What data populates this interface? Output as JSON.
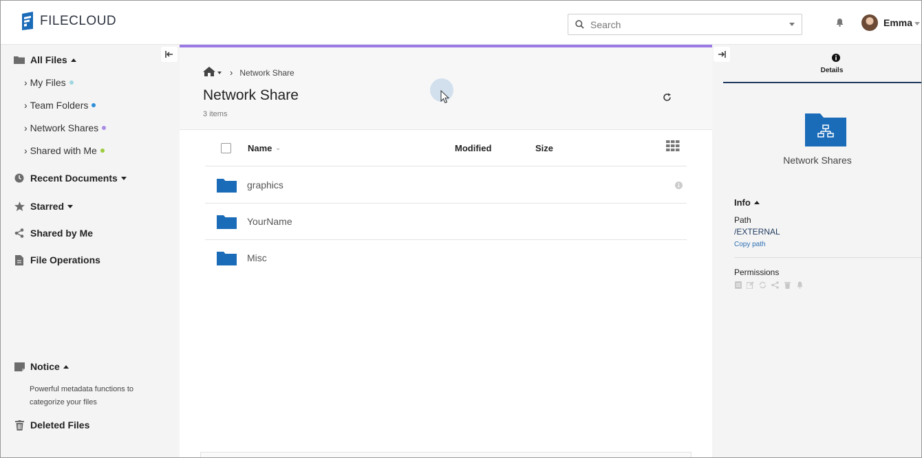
{
  "app": {
    "logo_text": "FILECLOUD",
    "brand_color": "#1a6bb8",
    "accent_color": "#9b7ae6"
  },
  "header": {
    "search_placeholder": "Search",
    "user_name": "Emma"
  },
  "sidebar": {
    "all_files": "All Files",
    "sub_items": [
      {
        "label": "My Files",
        "dot_color": "#9fd7e0"
      },
      {
        "label": "Team Folders",
        "dot_color": "#2e8fd8"
      },
      {
        "label": "Network Shares",
        "dot_color": "#a98be6"
      },
      {
        "label": "Shared with Me",
        "dot_color": "#9ccc3c"
      }
    ],
    "recent_documents": "Recent Documents",
    "starred": "Starred",
    "shared_by_me": "Shared by Me",
    "file_operations": "File Operations",
    "notice": "Notice",
    "notice_text": "Powerful metadata functions to categorize your files",
    "deleted_files": "Deleted Files"
  },
  "main": {
    "breadcrumb_current": "Network Share",
    "title": "Network Share",
    "item_count": "3 items",
    "columns": {
      "name": "Name",
      "modified": "Modified",
      "size": "Size"
    },
    "files": [
      {
        "name": "graphics"
      },
      {
        "name": "YourName"
      },
      {
        "name": "Misc"
      }
    ]
  },
  "details": {
    "tab_label": "Details",
    "folder_label": "Network Shares",
    "info_heading": "Info",
    "path_label": "Path",
    "path_value": "/EXTERNAL",
    "copy_path": "Copy path",
    "permissions_heading": "Permissions"
  }
}
